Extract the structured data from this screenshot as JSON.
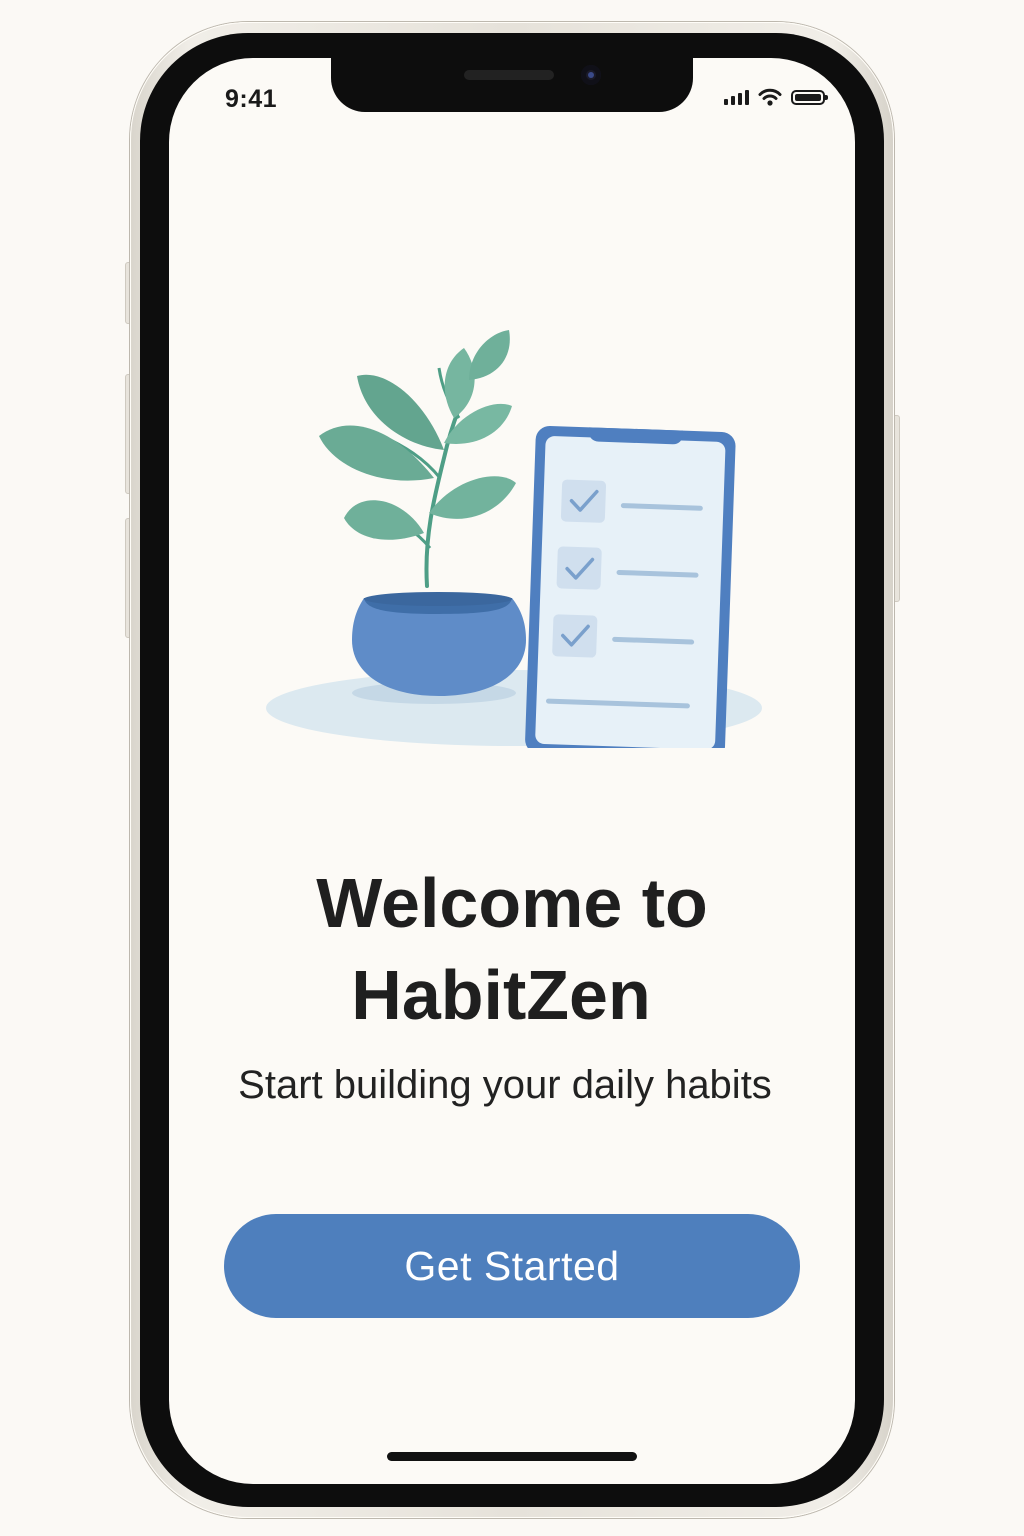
{
  "status_bar": {
    "time": "9:41",
    "icons": [
      "signal-icon",
      "wifi-icon",
      "battery-icon"
    ]
  },
  "illustration": {
    "subject": [
      "plant-pot",
      "phone-checklist"
    ],
    "checked_items": 3
  },
  "welcome": {
    "title_line1": "Welcome to",
    "title_line2": "HabitZen",
    "subtitle": "Start building your daily habits"
  },
  "cta": {
    "label": "Get Started"
  },
  "colors": {
    "background": "#fcfaf6",
    "accent": "#4e7fbd",
    "leaf": "#6fb09a",
    "pot": "#5f8cc8"
  }
}
